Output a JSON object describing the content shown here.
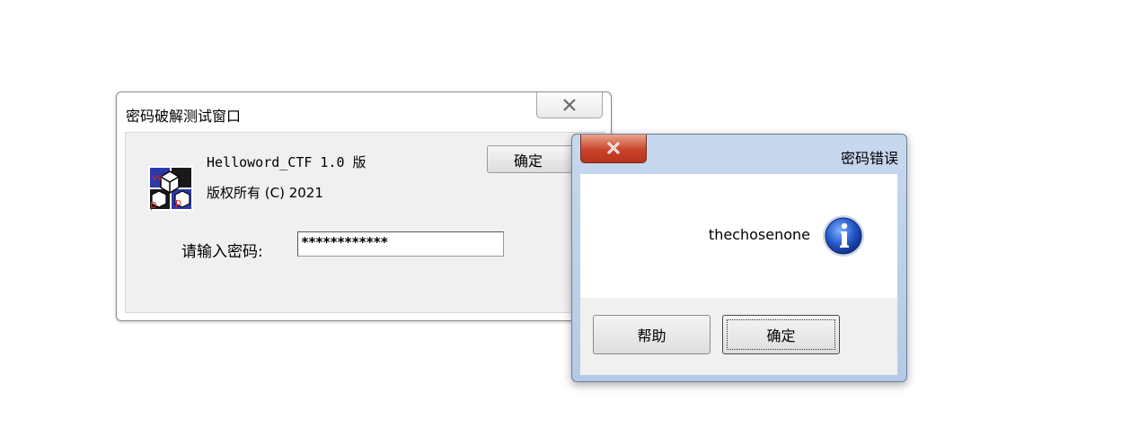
{
  "main_dialog": {
    "title": "密码破解测试窗口",
    "about_line1": "Helloword_CTF 1.0 版",
    "about_line2": "版权所有 (C) 2021",
    "ok_label": "确定",
    "password_label": "请输入密码:",
    "password_value": "************",
    "close_icon": "close-icon",
    "app_icon": "app-icon"
  },
  "message_box": {
    "title": "密码错误",
    "message": "thechosenone",
    "icon": "info-icon",
    "help_label": "帮助",
    "ok_label": "确定",
    "close_icon": "close-icon",
    "colors": {
      "close_red": "#c9442b",
      "frame": "#b5c9e6"
    }
  }
}
